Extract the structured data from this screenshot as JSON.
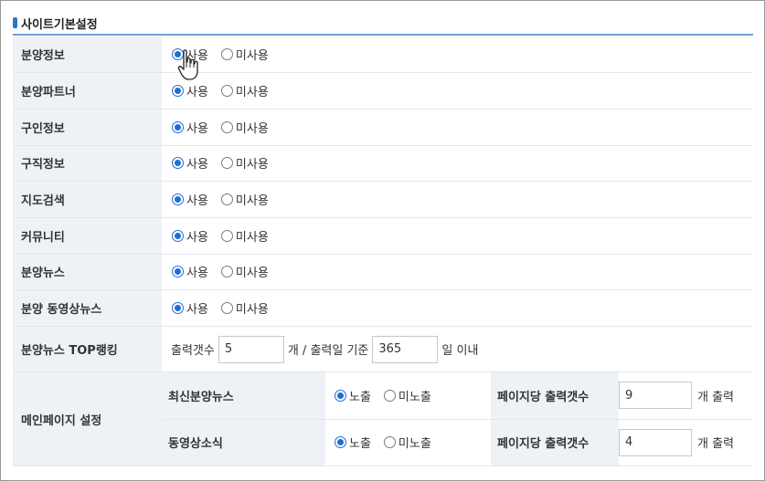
{
  "section_title": "사이트기본설정",
  "radio_labels": {
    "use": "사용",
    "not_use": "미사용",
    "show": "노출",
    "hide": "미노출"
  },
  "rows": [
    {
      "label": "분양정보",
      "selected": "use"
    },
    {
      "label": "분양파트너",
      "selected": "use"
    },
    {
      "label": "구인정보",
      "selected": "use"
    },
    {
      "label": "구직정보",
      "selected": "use"
    },
    {
      "label": "지도검색",
      "selected": "use"
    },
    {
      "label": "커뮤니티",
      "selected": "use"
    },
    {
      "label": "분양뉴스",
      "selected": "use"
    },
    {
      "label": "분양 동영상뉴스",
      "selected": "use"
    }
  ],
  "top_ranking": {
    "label": "분양뉴스 TOP랭킹",
    "count_prefix": "출력갯수",
    "count_value": "5",
    "middle_text": "개 / 출력일 기준",
    "days_value": "365",
    "suffix": "일 이내"
  },
  "main_page": {
    "label": "메인페이지 설정",
    "per_page_label": "페이지당 출력갯수",
    "unit_text": "개 출력",
    "items": [
      {
        "label": "최신분양뉴스",
        "selected": "show",
        "count": "9"
      },
      {
        "label": "동영상소식",
        "selected": "show",
        "count": "4"
      }
    ]
  },
  "colors": {
    "accent": "#2b76c8",
    "radio_checked": "#1f6fd0",
    "label_bg": "#eef2f7"
  },
  "cursor_icon": "hand-pointer-icon"
}
